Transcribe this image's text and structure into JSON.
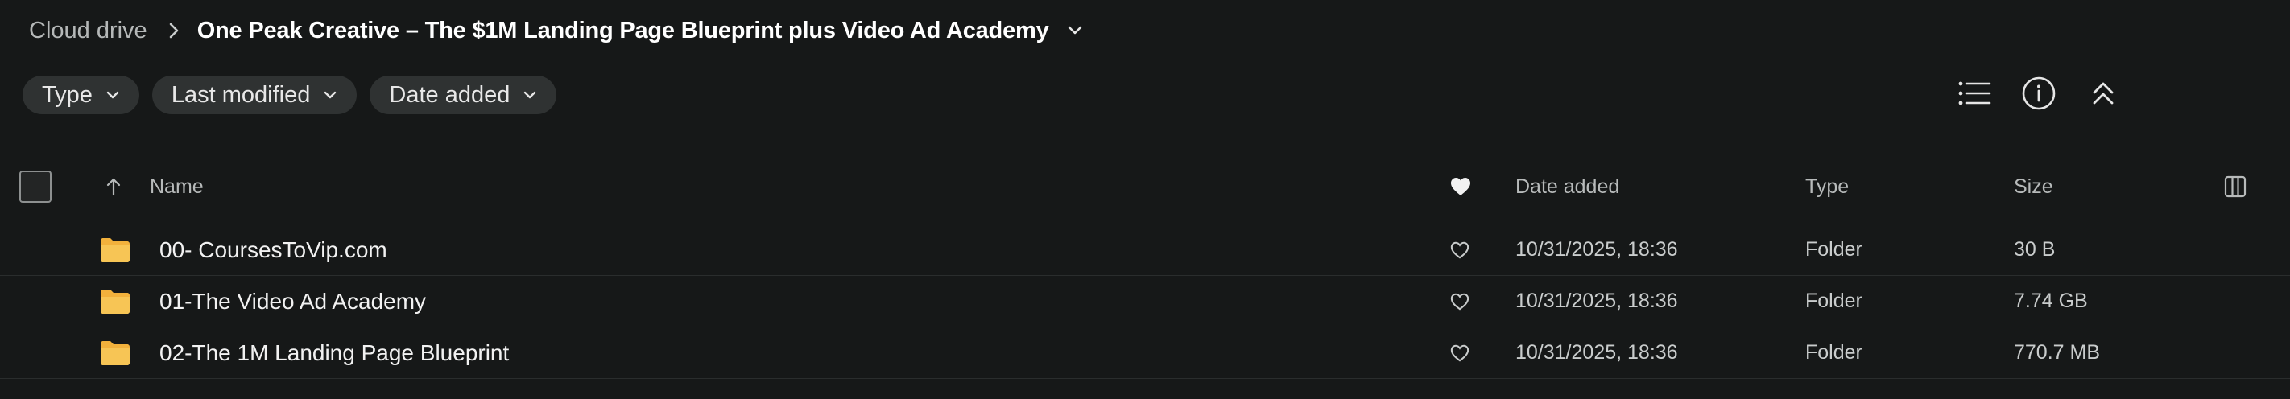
{
  "breadcrumb": {
    "root": "Cloud drive",
    "current": "One Peak Creative – The $1M Landing Page Blueprint plus Video Ad Academy"
  },
  "filters": [
    {
      "label": "Type"
    },
    {
      "label": "Last modified"
    },
    {
      "label": "Date added"
    }
  ],
  "toolbar": {
    "icons": [
      "list-view-icon",
      "info-icon",
      "collapse-icon"
    ]
  },
  "table": {
    "columns": {
      "name": "Name",
      "date_added": "Date added",
      "type": "Type",
      "size": "Size"
    },
    "sort": "ascending",
    "rows": [
      {
        "name": "00- CoursesToVip.com",
        "date_added": "10/31/2025, 18:36",
        "type": "Folder",
        "size": "30 B"
      },
      {
        "name": "01-The Video Ad Academy",
        "date_added": "10/31/2025, 18:36",
        "type": "Folder",
        "size": "7.74 GB"
      },
      {
        "name": "02-The 1M Landing Page Blueprint",
        "date_added": "10/31/2025, 18:36",
        "type": "Folder",
        "size": "770.7 MB"
      }
    ]
  },
  "colors": {
    "background": "#161818",
    "chip": "#2f3232",
    "folder": "#f2b13c",
    "divider": "#2a2d2d"
  }
}
